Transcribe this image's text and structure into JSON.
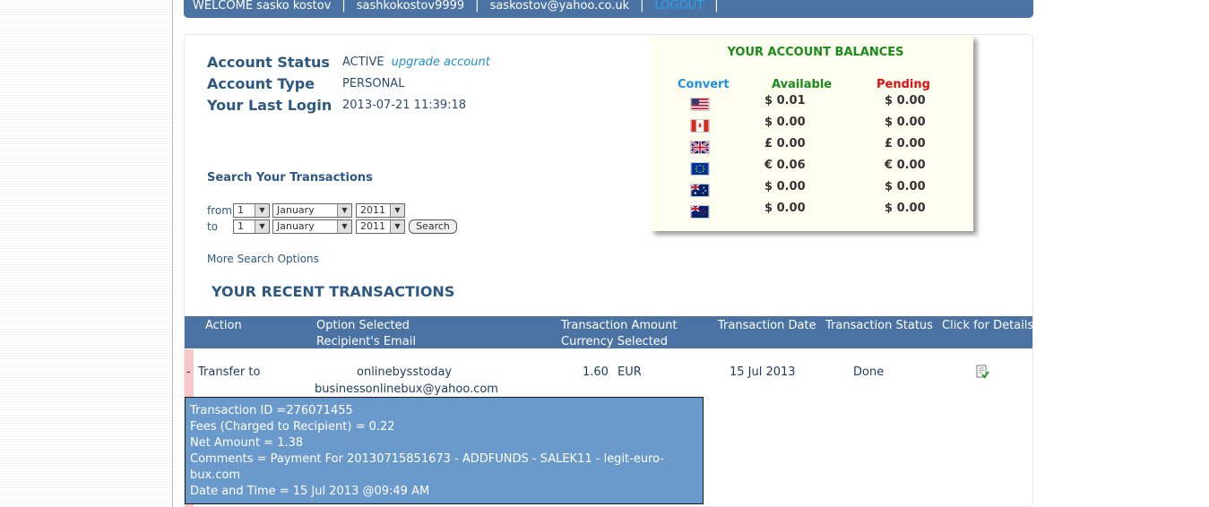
{
  "topbar": {
    "welcome": "WELCOME sasko kostov",
    "username": "sashkokostov9999",
    "email": "saskostov@yahoo.co.uk",
    "logout": "LOGOUT",
    "separator": "|"
  },
  "account": {
    "status_label": "Account Status",
    "status_value": "ACTIVE",
    "upgrade_link": "upgrade account",
    "type_label": "Account Type",
    "type_value": "PERSONAL",
    "last_login_label": "Your Last Login",
    "last_login_value": "2013-07-21 11:39:18"
  },
  "search": {
    "title": "Search Your Transactions",
    "from_label": "from",
    "to_label": "to",
    "from_day": "1",
    "from_month": "January",
    "from_year": "2011",
    "to_day": "1",
    "to_month": "January",
    "to_year": "2011",
    "button": "Search",
    "more_options": "More Search Options"
  },
  "balances": {
    "title": "YOUR ACCOUNT BALANCES",
    "col_convert": "Convert",
    "col_available": "Available",
    "col_pending": "Pending",
    "rows": [
      {
        "flag": "us-flag-icon",
        "available": "$ 0.01",
        "pending": "$ 0.00"
      },
      {
        "flag": "canada-flag-icon",
        "available": "$ 0.00",
        "pending": "$ 0.00"
      },
      {
        "flag": "uk-flag-icon",
        "available": "£ 0.00",
        "pending": "£ 0.00"
      },
      {
        "flag": "eu-flag-icon",
        "available": "€ 0.06",
        "pending": "€ 0.00"
      },
      {
        "flag": "australia-flag-icon",
        "available": "$ 0.00",
        "pending": "$ 0.00"
      },
      {
        "flag": "newzealand-flag-icon",
        "available": "$ 0.00",
        "pending": "$ 0.00"
      }
    ],
    "colors": {
      "title": "#1a8a1a",
      "convert": "#1e90e0",
      "available": "#1a8a1a",
      "pending": "#e01010"
    }
  },
  "recent": {
    "title": "YOUR RECENT TRANSACTIONS",
    "headers": {
      "action": "Action",
      "option": "Option Selected",
      "recipient": "Recipient's Email",
      "amount": "Transaction Amount",
      "currency": "Currency Selected",
      "date": "Transaction Date",
      "status": "Transaction Status",
      "details": "Click for Details"
    },
    "row": {
      "toggle": "-",
      "action": "Transfer to",
      "option": "onlinebysstoday",
      "recipient": "businessonlinebux@yahoo.com",
      "amount": "1.60",
      "currency": "EUR",
      "date": "15 Jul 2013",
      "status": "Done",
      "details_icon": "document-check-icon"
    },
    "details": {
      "id": "Transaction ID =276071455",
      "fees": "Fees (Charged to Recipient) = 0.22",
      "net": "Net Amount = 1.38",
      "comments": "Comments = Payment For 20130715851673 - ADDFUNDS - SALEK11 - legit-euro-bux.com",
      "datetime": "Date and Time = 15 Jul 2013 @09:49 AM"
    }
  },
  "colors": {
    "brand": "#4a73a3",
    "heading": "#2c5884",
    "link": "#1e90c8",
    "details_bg": "#6a9acc"
  }
}
